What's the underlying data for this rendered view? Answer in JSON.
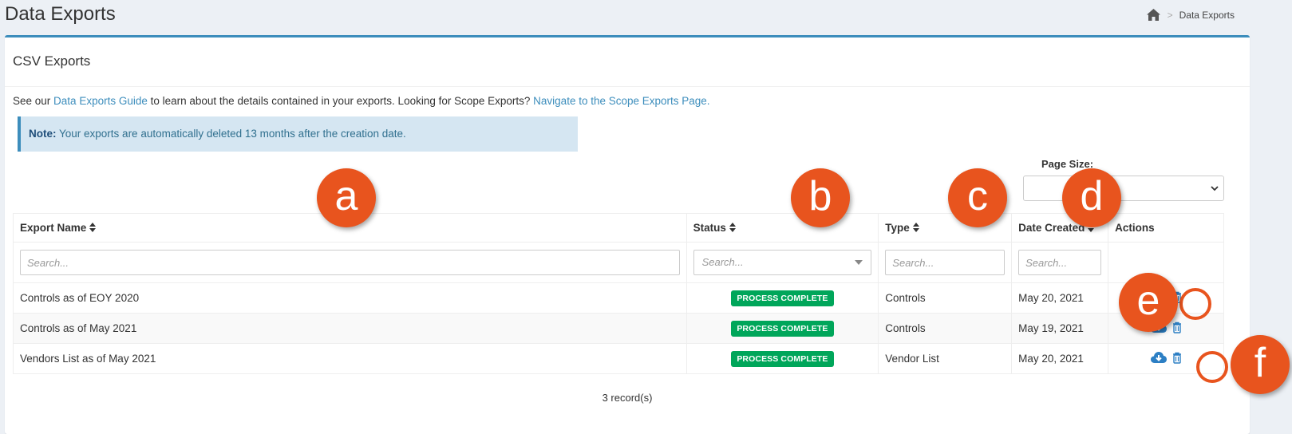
{
  "page": {
    "title": "Data Exports",
    "breadcrumb": {
      "home_icon": "home-icon",
      "separator": ">",
      "current": "Data Exports"
    }
  },
  "box": {
    "title": "CSV Exports",
    "intro": {
      "prefix": "See our ",
      "guide_link": "Data Exports Guide",
      "middle": " to learn about the details contained in your exports. Looking for Scope Exports? ",
      "scope_link": "Navigate to the Scope Exports Page."
    },
    "note": {
      "label": "Note:",
      "text": " Your exports are automatically deleted 13 months after the creation date."
    },
    "page_size_label": "Page Size:"
  },
  "table": {
    "columns": [
      {
        "label": "Export Name",
        "sortable": true
      },
      {
        "label": "Status",
        "sortable": true
      },
      {
        "label": "Type",
        "sortable": true
      },
      {
        "label": "Date Created",
        "sortable": true
      },
      {
        "label": "Actions",
        "sortable": false
      }
    ],
    "filters": {
      "name_placeholder": "Search...",
      "status_placeholder": "Search...",
      "type_placeholder": "Search...",
      "date_placeholder": "Search..."
    },
    "rows": [
      {
        "name": "Controls as of EOY 2020",
        "status": "PROCESS COMPLETE",
        "type": "Controls",
        "date": "May 20, 2021"
      },
      {
        "name": "Controls as of May 2021",
        "status": "PROCESS COMPLETE",
        "type": "Controls",
        "date": "May 19, 2021"
      },
      {
        "name": "Vendors List as of May 2021",
        "status": "PROCESS COMPLETE",
        "type": "Vendor List",
        "date": "May 20, 2021"
      }
    ],
    "records_text": "3 record(s)"
  },
  "callouts": {
    "a": "a",
    "b": "b",
    "c": "c",
    "d": "d",
    "e": "e",
    "f": "f"
  },
  "colors": {
    "accent": "#3c8dbc",
    "success": "#00a65a",
    "callout": "#e8541e"
  },
  "icons": [
    "home-icon",
    "sort-icon",
    "download-icon",
    "trash-icon",
    "chevron-down-icon"
  ]
}
